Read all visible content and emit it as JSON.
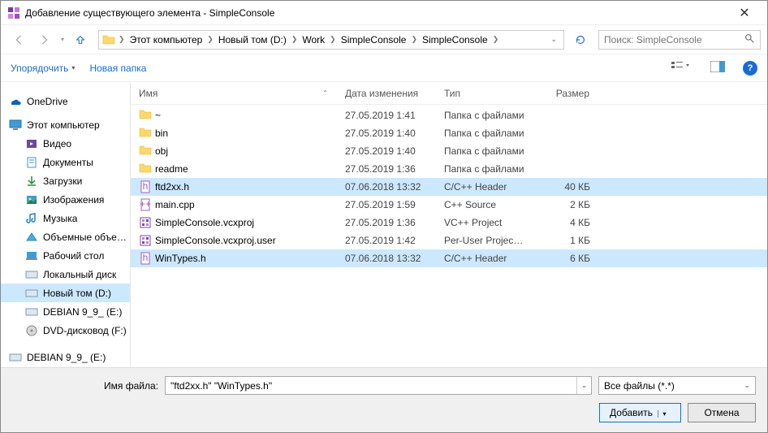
{
  "window": {
    "title": "Добавление существующего элемента - SimpleConsole"
  },
  "breadcrumb": {
    "items": [
      "Этот компьютер",
      "Новый том (D:)",
      "Work",
      "SimpleConsole",
      "SimpleConsole"
    ]
  },
  "search": {
    "placeholder": "Поиск: SimpleConsole"
  },
  "toolbar": {
    "organize": "Упорядочить",
    "new_folder": "Новая папка"
  },
  "sidebar": {
    "onedrive": "OneDrive",
    "this_pc": "Этот компьютер",
    "items": [
      {
        "label": "Видео"
      },
      {
        "label": "Документы"
      },
      {
        "label": "Загрузки"
      },
      {
        "label": "Изображения"
      },
      {
        "label": "Музыка"
      },
      {
        "label": "Объемные объекты"
      },
      {
        "label": "Рабочий стол"
      },
      {
        "label": "Локальный диск"
      },
      {
        "label": "Новый том (D:)"
      },
      {
        "label": "DEBIAN 9_9_ (E:)"
      },
      {
        "label": "DVD-дисковод (F:)"
      }
    ],
    "detached": "DEBIAN 9_9_ (E:)"
  },
  "columns": {
    "name": "Имя",
    "date": "Дата изменения",
    "type": "Тип",
    "size": "Размер"
  },
  "files": [
    {
      "name": "~",
      "date": "27.05.2019 1:41",
      "type": "Папка с файлами",
      "size": "",
      "kind": "folder",
      "selected": false
    },
    {
      "name": "bin",
      "date": "27.05.2019 1:40",
      "type": "Папка с файлами",
      "size": "",
      "kind": "folder",
      "selected": false
    },
    {
      "name": "obj",
      "date": "27.05.2019 1:40",
      "type": "Папка с файлами",
      "size": "",
      "kind": "folder",
      "selected": false
    },
    {
      "name": "readme",
      "date": "27.05.2019 1:36",
      "type": "Папка с файлами",
      "size": "",
      "kind": "folder",
      "selected": false
    },
    {
      "name": "ftd2xx.h",
      "date": "07.06.2018 13:32",
      "type": "C/C++ Header",
      "size": "40 КБ",
      "kind": "h",
      "selected": true
    },
    {
      "name": "main.cpp",
      "date": "27.05.2019 1:59",
      "type": "C++ Source",
      "size": "2 КБ",
      "kind": "cpp",
      "selected": false
    },
    {
      "name": "SimpleConsole.vcxproj",
      "date": "27.05.2019 1:36",
      "type": "VC++ Project",
      "size": "4 КБ",
      "kind": "proj",
      "selected": false
    },
    {
      "name": "SimpleConsole.vcxproj.user",
      "date": "27.05.2019 1:42",
      "type": "Per-User Project O...",
      "size": "1 КБ",
      "kind": "proj",
      "selected": false
    },
    {
      "name": "WinTypes.h",
      "date": "07.06.2018 13:32",
      "type": "C/C++ Header",
      "size": "6 КБ",
      "kind": "h",
      "selected": true
    }
  ],
  "bottom": {
    "filename_label": "Имя файла:",
    "filename_value": "\"ftd2xx.h\" \"WinTypes.h\"",
    "filter": "Все файлы (*.*)",
    "add": "Добавить",
    "cancel": "Отмена"
  }
}
